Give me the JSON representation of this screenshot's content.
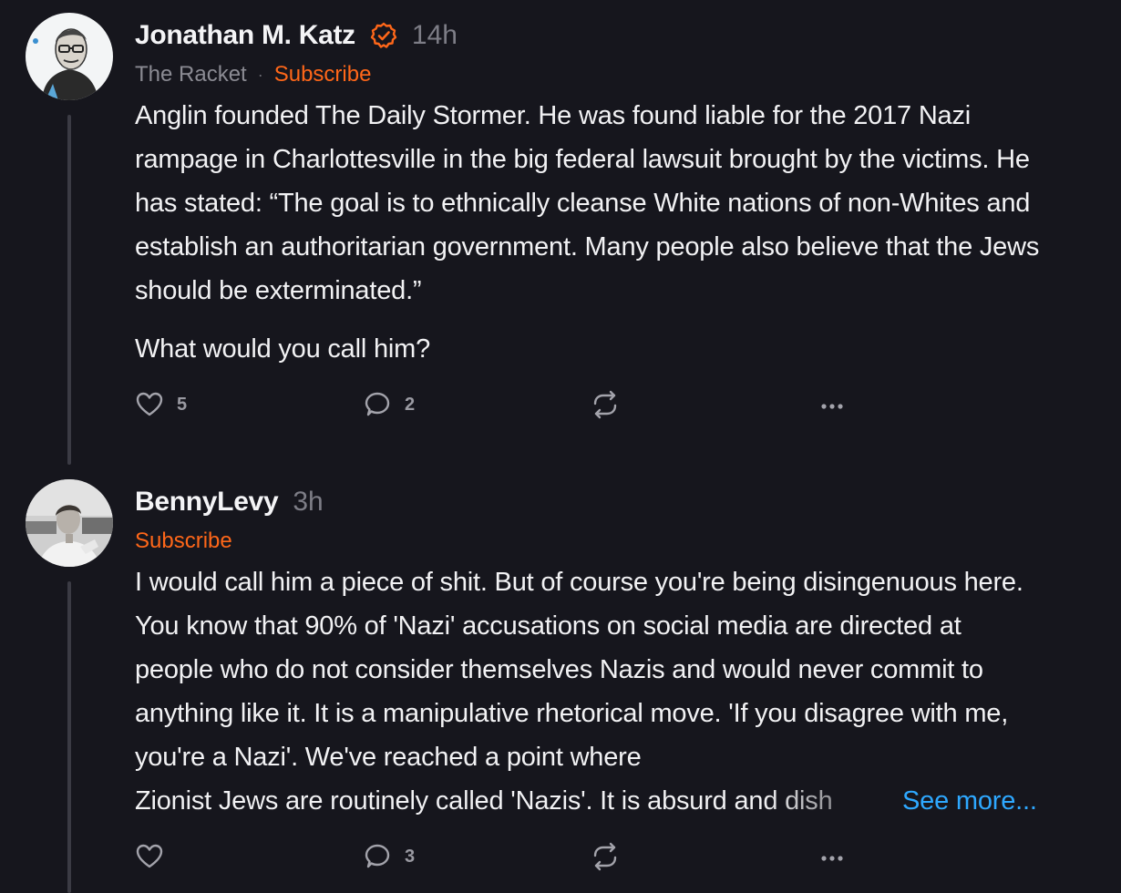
{
  "comments": [
    {
      "author": "Jonathan M. Katz",
      "verified_icon": "verified-check-icon",
      "time": "14h",
      "publication": "The Racket",
      "separator": "·",
      "subscribe_label": "Subscribe",
      "body": [
        "Anglin founded The Daily Stormer. He was found liable for the 2017 Nazi rampage in Charlottesville in the big federal lawsuit brought by the victims. He has stated: “The goal is to ethnically cleanse White nations of non-Whites and establish an authoritarian government. Many people also believe that the Jews should be exterminated.”",
        "What would you call him?"
      ],
      "like_count": "5",
      "reply_count": "2"
    },
    {
      "author": "BennyLevy",
      "time": "3h",
      "subscribe_label": "Subscribe",
      "body_visible": "I would call him a piece of shit. But of course you're being disingenuous here. You know that 90% of 'Nazi' accusations on social media are directed at people who do not consider themselves Nazis and would never commit to anything like it. It is a manipulative rhetorical move. 'If you disagree with me, you're a Nazi'. We've reached a point where",
      "body_faded": "Zionist Jews are routinely called 'Nazis'. It is absurd and dish",
      "see_more_label": "See more...",
      "like_count": "",
      "reply_count": "3"
    }
  ],
  "colors": {
    "background": "#16161d",
    "accent_orange": "#ff6719",
    "link_blue": "#2ea8ff",
    "muted_text": "#7d7d86"
  },
  "icons": [
    "heart-icon",
    "comment-bubble-icon",
    "restack-icon",
    "more-dots-icon"
  ]
}
